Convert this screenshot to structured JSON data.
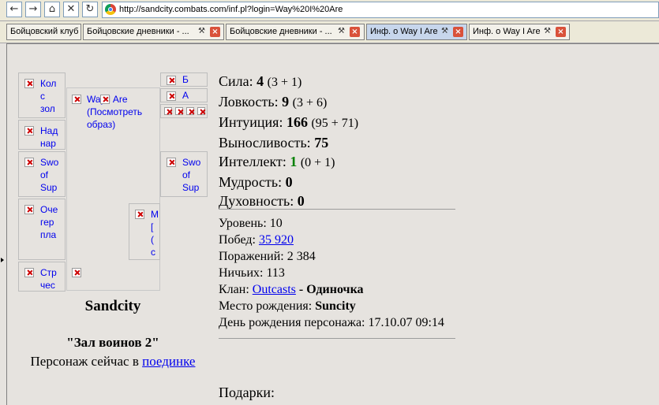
{
  "browser": {
    "url": "http://sandcity.combats.com/inf.pl?login=Way%20I%20Are",
    "tabs": [
      {
        "label": "Бойцовский клуб"
      },
      {
        "label": "Бойцовские дневники - ..."
      },
      {
        "label": "Бойцовские дневники - ..."
      },
      {
        "label": "Инф. о Way I Are"
      },
      {
        "label": "Инф. о Way I Are"
      }
    ]
  },
  "equipment": {
    "slots": [
      {
        "alt": "Кол\nс\nзол"
      },
      {
        "alt": "Над\nнар"
      },
      {
        "alt": "Swo\nof\nSup"
      },
      {
        "alt": "Оче\nгер\nпла"
      },
      {
        "alt": "Стр\nчес"
      },
      {
        "alt": "Way I Are\n(Посмотреть\nобраз)"
      },
      {
        "alt": "Swo\nof\nSup"
      },
      {
        "alt": "М\n[\n(\nс"
      },
      {
        "alt": "Б"
      },
      {
        "alt": "А"
      }
    ],
    "city": "Sandcity",
    "location": "\"Зал воинов 2\"",
    "status_prefix": "Персонаж сейчас в",
    "status_link": "поединке"
  },
  "stats": [
    {
      "label": "Сила:",
      "value": "4",
      "detail": "(3 + 1)"
    },
    {
      "label": "Ловкость:",
      "value": "9",
      "detail": "(3 + 6)"
    },
    {
      "label": "Интуиция:",
      "value": "166",
      "detail": "(95 + 71)"
    },
    {
      "label": "Выносливость:",
      "value": "75",
      "detail": ""
    },
    {
      "label": "Интеллект:",
      "value": "1",
      "detail": "(0 + 1)",
      "color": "#008000"
    },
    {
      "label": "Мудрость:",
      "value": "0",
      "detail": ""
    },
    {
      "label": "Духовность:",
      "value": "0",
      "detail": ""
    }
  ],
  "info": {
    "level_label": "Уровень:",
    "level": "10",
    "wins_label": "Побед:",
    "wins": "35 920",
    "losses_label": "Поражений:",
    "losses": "2 384",
    "draws_label": "Ничьих:",
    "draws": "113",
    "clan_label": "Клан:",
    "clan_name": "Outcasts",
    "clan_sep": "-",
    "clan_rank": "Одиночка",
    "birthplace_label": "Место рождения:",
    "birthplace": "Suncity",
    "birthday_label": "День рождения персонажа:",
    "birthday": "17.10.07 09:14"
  },
  "gifts_label": "Подарки:"
}
